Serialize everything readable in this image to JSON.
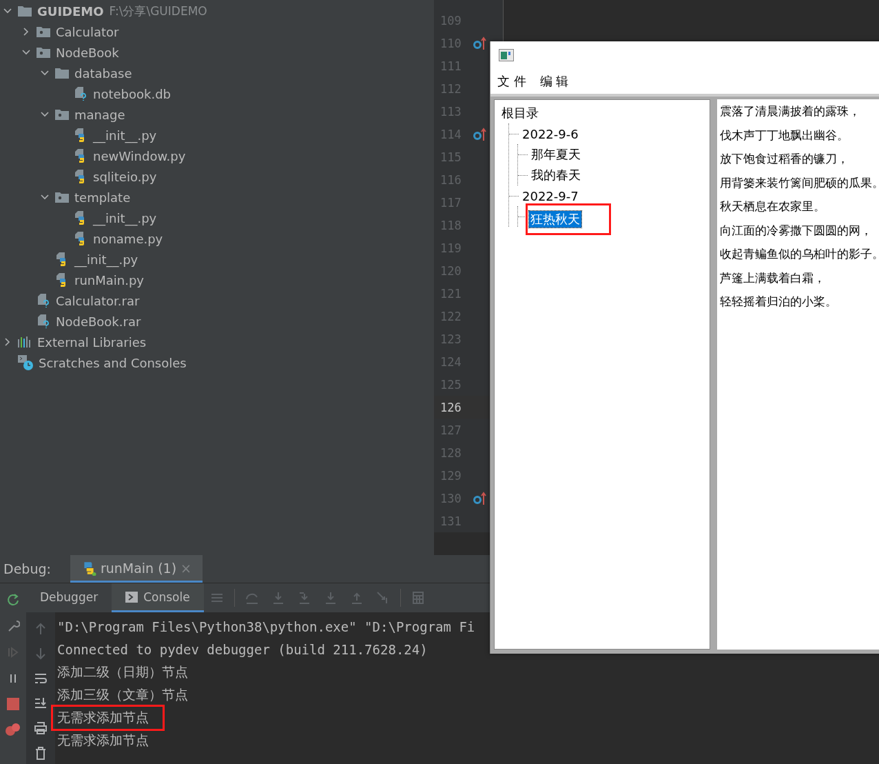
{
  "project_tree": [
    {
      "name": "GUIDEMO",
      "path": "F:\\分享\\GUIDEMO",
      "kind": "folder",
      "expanded": true,
      "children": [
        {
          "name": "Calculator",
          "kind": "package",
          "expanded": false
        },
        {
          "name": "NodeBook",
          "kind": "package",
          "expanded": true,
          "children": [
            {
              "name": "database",
              "kind": "folder",
              "expanded": true,
              "children": [
                {
                  "name": "notebook.db",
                  "kind": "unknown"
                }
              ]
            },
            {
              "name": "manage",
              "kind": "package",
              "expanded": true,
              "children": [
                {
                  "name": "__init__.py",
                  "kind": "python"
                },
                {
                  "name": "newWindow.py",
                  "kind": "python"
                },
                {
                  "name": "sqliteio.py",
                  "kind": "python"
                }
              ]
            },
            {
              "name": "template",
              "kind": "package",
              "expanded": true,
              "children": [
                {
                  "name": "__init__.py",
                  "kind": "python"
                },
                {
                  "name": "noname.py",
                  "kind": "python"
                }
              ]
            },
            {
              "name": "__init__.py",
              "kind": "python"
            },
            {
              "name": "runMain.py",
              "kind": "python"
            }
          ]
        },
        {
          "name": "Calculator.rar",
          "kind": "unknown"
        },
        {
          "name": "NodeBook.rar",
          "kind": "unknown"
        }
      ]
    },
    {
      "name": "External Libraries",
      "kind": "libraries",
      "expanded": false
    },
    {
      "name": "Scratches and Consoles",
      "kind": "scratches"
    }
  ],
  "editor": {
    "lines": [
      {
        "number": "109",
        "marker": false,
        "current": false
      },
      {
        "number": "110",
        "marker": true,
        "current": false
      },
      {
        "number": "111",
        "marker": false,
        "current": false
      },
      {
        "number": "112",
        "marker": false,
        "current": false
      },
      {
        "number": "113",
        "marker": false,
        "current": false
      },
      {
        "number": "114",
        "marker": true,
        "current": false
      },
      {
        "number": "115",
        "marker": false,
        "current": false
      },
      {
        "number": "116",
        "marker": false,
        "current": false
      },
      {
        "number": "117",
        "marker": false,
        "current": false
      },
      {
        "number": "118",
        "marker": false,
        "current": false
      },
      {
        "number": "119",
        "marker": false,
        "current": false
      },
      {
        "number": "120",
        "marker": false,
        "current": false
      },
      {
        "number": "121",
        "marker": false,
        "current": false
      },
      {
        "number": "122",
        "marker": false,
        "current": false
      },
      {
        "number": "123",
        "marker": false,
        "current": false
      },
      {
        "number": "124",
        "marker": false,
        "current": false
      },
      {
        "number": "125",
        "marker": false,
        "current": false
      },
      {
        "number": "126",
        "marker": false,
        "current": true
      },
      {
        "number": "127",
        "marker": false,
        "current": false
      },
      {
        "number": "128",
        "marker": false,
        "current": false
      },
      {
        "number": "129",
        "marker": false,
        "current": false
      },
      {
        "number": "130",
        "marker": true,
        "current": false
      },
      {
        "number": "131",
        "marker": false,
        "current": false
      }
    ]
  },
  "app_window": {
    "menu": [
      "文 件",
      "编 辑"
    ],
    "tree": [
      {
        "label": "根目录",
        "selected": false,
        "highlighted": false,
        "children": [
          {
            "label": "2022-9-6",
            "selected": false,
            "highlighted": false,
            "children": [
              {
                "label": "那年夏天",
                "selected": false,
                "highlighted": false
              },
              {
                "label": "我的春天",
                "selected": false,
                "highlighted": false
              }
            ]
          },
          {
            "label": "2022-9-7",
            "selected": false,
            "highlighted": false,
            "children": [
              {
                "label": "狂热秋天",
                "selected": true,
                "highlighted": true
              }
            ]
          }
        ]
      }
    ],
    "text_lines": [
      "震落了清晨满披着的露珠，",
      "伐木声丁丁地飘出幽谷。",
      "放下饱食过稻香的镰刀，",
      "用背篓来装竹篱间肥硕的瓜果。",
      "秋天栖息在农家里。",
      "向江面的冷雾撒下圆圆的网，",
      "收起青鳊鱼似的乌桕叶的影子。",
      "芦篷上满载着白霜，",
      "轻轻摇着归泊的小桨。"
    ]
  },
  "debug": {
    "label": "Debug:",
    "tab": {
      "title": "runMain (1)",
      "close": "×"
    },
    "subtabs": [
      {
        "label": "Debugger",
        "selected": false
      },
      {
        "label": "Console",
        "selected": true
      }
    ],
    "console": [
      {
        "text": "\"D:\\Program Files\\Python38\\python.exe\" \"D:\\Program Fi",
        "highlighted": false
      },
      {
        "text": "Connected to pydev debugger (build 211.7628.24)",
        "highlighted": false
      },
      {
        "text": "添加二级（日期）节点",
        "highlighted": false
      },
      {
        "text": "添加三级（文章）节点",
        "highlighted": false
      },
      {
        "text": "无需求添加节点",
        "highlighted": true
      },
      {
        "text": "无需求添加节点",
        "highlighted": false
      }
    ]
  }
}
